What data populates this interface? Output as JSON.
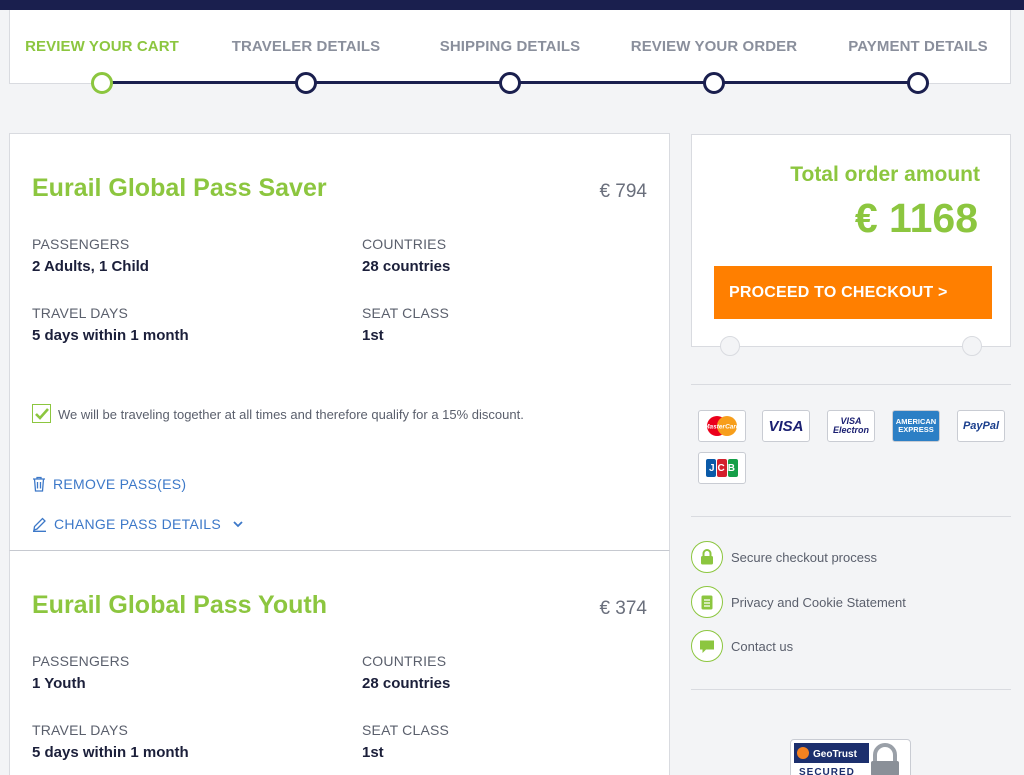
{
  "steps": [
    {
      "label": "REVIEW YOUR CART",
      "active": true
    },
    {
      "label": "TRAVELER DETAILS",
      "active": false
    },
    {
      "label": "SHIPPING DETAILS",
      "active": false
    },
    {
      "label": "REVIEW YOUR ORDER",
      "active": false
    },
    {
      "label": "PAYMENT DETAILS",
      "active": false
    }
  ],
  "passes": [
    {
      "title": "Eurail Global Pass Saver",
      "price": "€ 794",
      "passengers_label": "PASSENGERS",
      "passengers": "2 Adults, 1 Child",
      "countries_label": "COUNTRIES",
      "countries": "28 countries",
      "travel_days_label": "TRAVEL DAYS",
      "travel_days": "5 days within 1 month",
      "seat_class_label": "SEAT CLASS",
      "seat_class": "1st",
      "discount_text": "We will be traveling together at all times and therefore qualify for a 15% discount.",
      "remove_label": "REMOVE PASS(ES)",
      "change_label": "CHANGE PASS DETAILS"
    },
    {
      "title": "Eurail Global Pass Youth",
      "price": "€ 374",
      "passengers_label": "PASSENGERS",
      "passengers": "1 Youth",
      "countries_label": "COUNTRIES",
      "countries": "28 countries",
      "travel_days_label": "TRAVEL DAYS",
      "travel_days": "5 days within 1 month",
      "seat_class_label": "SEAT CLASS",
      "seat_class": "1st"
    }
  ],
  "summary": {
    "total_label": "Total order amount",
    "total_amount": "€ 1168",
    "checkout_label": "PROCEED TO CHECKOUT >"
  },
  "payment_methods": [
    {
      "name": "mastercard-icon",
      "label": "MasterCard"
    },
    {
      "name": "visa-icon",
      "label": "VISA"
    },
    {
      "name": "visa-electron-icon",
      "label": "VISA Electron"
    },
    {
      "name": "american-express-icon",
      "label": "AMERICAN EXPRESS"
    },
    {
      "name": "paypal-icon",
      "label": "PayPal"
    },
    {
      "name": "jcb-icon",
      "label": "JCB"
    }
  ],
  "info_links": [
    {
      "name": "secure-checkout-link",
      "icon": "lock-icon",
      "label": "Secure checkout process"
    },
    {
      "name": "privacy-cookie-link",
      "icon": "document-icon",
      "label": "Privacy and Cookie Statement"
    },
    {
      "name": "contact-us-link",
      "icon": "chat-icon",
      "label": "Contact us"
    }
  ],
  "geotrust": {
    "brand": "GeoTrust",
    "secured": "SECURED"
  },
  "colors": {
    "accent": "#8cc63f",
    "navy": "#1a1f4e",
    "cta": "#ff7f00",
    "link": "#3c78c8"
  }
}
